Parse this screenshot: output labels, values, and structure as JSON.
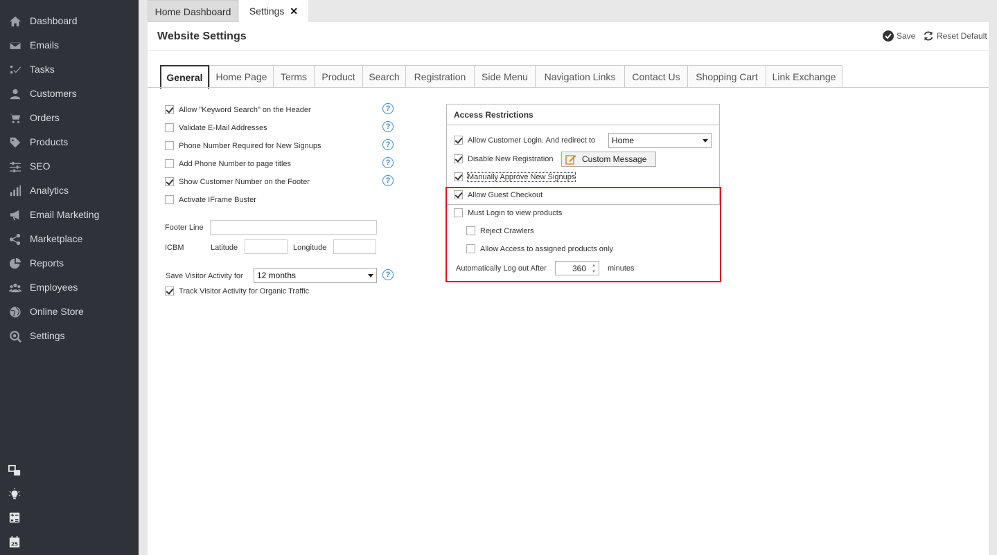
{
  "sidebar": {
    "items": [
      {
        "label": "Dashboard",
        "icon": "home-icon"
      },
      {
        "label": "Emails",
        "icon": "envelope-icon"
      },
      {
        "label": "Tasks",
        "icon": "tasks-icon"
      },
      {
        "label": "Customers",
        "icon": "user-icon"
      },
      {
        "label": "Orders",
        "icon": "cart-icon"
      },
      {
        "label": "Products",
        "icon": "tag-icon"
      },
      {
        "label": "SEO",
        "icon": "sliders-icon"
      },
      {
        "label": "Analytics",
        "icon": "bar-chart-icon"
      },
      {
        "label": "Email Marketing",
        "icon": "megaphone-icon"
      },
      {
        "label": "Marketplace",
        "icon": "share-icon"
      },
      {
        "label": "Reports",
        "icon": "pie-chart-icon"
      },
      {
        "label": "Employees",
        "icon": "users-icon"
      },
      {
        "label": "Online Store",
        "icon": "globe-icon"
      },
      {
        "label": "Settings",
        "icon": "gear-search-icon"
      }
    ],
    "tools": [
      "windows-icon",
      "lightbulb-icon",
      "calculator-icon",
      "calendar-icon"
    ],
    "calendar_day": "25"
  },
  "doc_tabs": {
    "home": "Home Dashboard",
    "settings": "Settings",
    "close": "✕"
  },
  "panel": {
    "title": "Website Settings",
    "save_label": "Save",
    "reset_label": "Reset Default"
  },
  "settings_tabs": [
    "General",
    "Home Page",
    "Terms",
    "Product",
    "Search",
    "Registration",
    "Side Menu",
    "Navigation Links",
    "Contact Us",
    "Shopping Cart",
    "Link Exchange"
  ],
  "general": {
    "options": [
      {
        "label": "Allow \"Keyword Search\" on the Header",
        "checked": true
      },
      {
        "label": "Validate E-Mail Addresses",
        "checked": false
      },
      {
        "label": "Phone Number Required for New Signups",
        "checked": false
      },
      {
        "label": "Add Phone Number to page titles",
        "checked": false
      },
      {
        "label": "Show Customer Number on the Footer",
        "checked": true
      },
      {
        "label": "Activate IFrame Buster",
        "checked": false
      }
    ],
    "help_glyph": "?",
    "footer_line_label": "Footer Line",
    "icbm_label": "ICBM",
    "latitude_label": "Latitude",
    "longitude_label": "Longitude",
    "visitor_activity_label": "Save Visitor Activity for",
    "visitor_activity_value": "12 months",
    "track_organic_label": "Track Visitor Activity for Organic Traffic",
    "track_organic_checked": true
  },
  "access": {
    "title": "Access Restrictions",
    "allow_login_label": "Allow Customer Login. And redirect to",
    "allow_login_checked": true,
    "redirect_value": "Home",
    "disable_registration_label": "Disable New Registration",
    "disable_registration_checked": true,
    "custom_message_label": "Custom Message",
    "manual_approve_label": "Manually Approve New Signups",
    "manual_approve_checked": true,
    "guest_checkout_label": "Allow Guest Checkout",
    "guest_checkout_checked": true,
    "must_login_label": "Must Login to view products",
    "must_login_checked": false,
    "reject_crawlers_label": "Reject Crawlers",
    "reject_crawlers_checked": false,
    "assigned_only_label": "Allow Access to assigned products only",
    "assigned_only_checked": false,
    "logout_label": "Automatically Log out After",
    "logout_value": "360",
    "logout_unit": "minutes"
  },
  "colors": {
    "sidebar_bg": "#2f3339",
    "highlight_border": "#e0141e",
    "help_icon": "#3b8bc9"
  }
}
